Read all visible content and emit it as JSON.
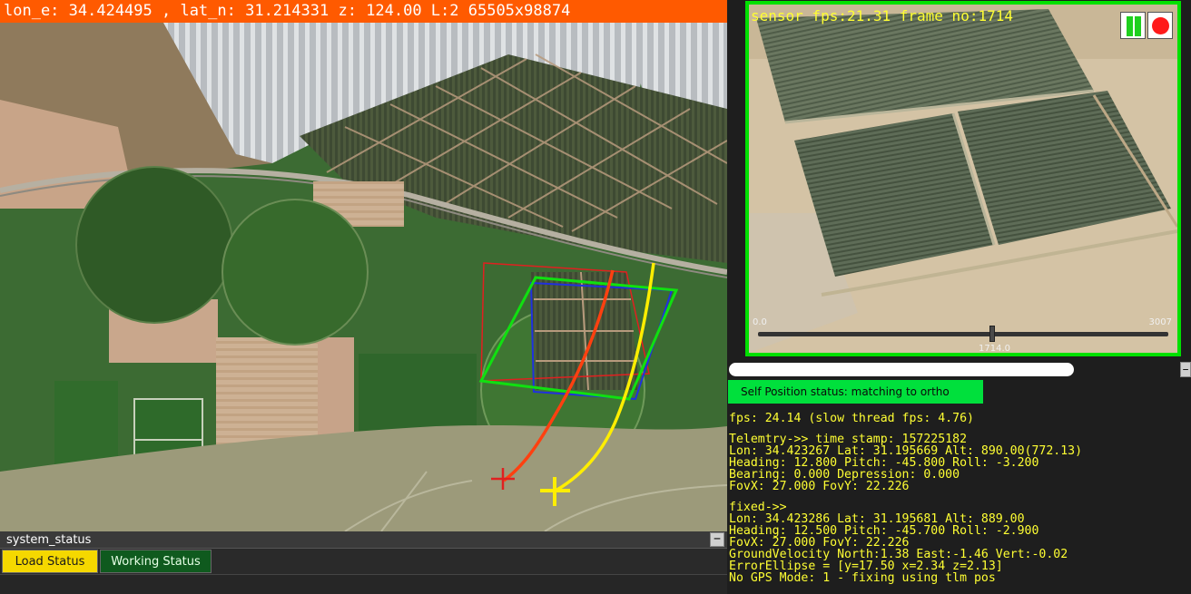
{
  "map": {
    "coord_text": "lon_e: 34.424495 , lat_n: 31.214331  z: 124.00 L:2  65505x98874"
  },
  "system_status": {
    "title": "system_status",
    "collapse_symbol": "−",
    "tabs": [
      {
        "label": "Load Status",
        "color": "#f5d800",
        "active": true
      },
      {
        "label": "Working Status",
        "color": "#0f5a1e",
        "active": false
      }
    ]
  },
  "sensor": {
    "info": "sensor fps:21.31 frame no:1714",
    "pause_icon": "pause-icon",
    "record_icon": "record-icon",
    "slider": {
      "min_label": "0.0",
      "max_label": "3007",
      "value_label": "1714.0",
      "min": 0,
      "max": 3007,
      "value": 1714
    },
    "frame_color": "#00e000"
  },
  "progress": {
    "fraction": 0.77,
    "collapse_symbol": "−"
  },
  "status": {
    "badge": "Self Position status: matching to ortho",
    "badge_color": "#00e03c",
    "text_color": "#ffff33",
    "fps_line": "fps: 24.14 (slow thread fps: 4.76)",
    "telemetry_lines": [
      "Telemtry->> time stamp: 157225182",
      "Lon: 34.423267 Lat: 31.195669 Alt: 890.00(772.13)",
      "Heading: 12.800 Pitch: -45.800 Roll: -3.200",
      "Bearing: 0.000 Depression: 0.000",
      "FovX: 27.000 FovY: 22.226"
    ],
    "fixed_lines": [
      "fixed->>",
      "Lon: 34.423286 Lat: 31.195681 Alt: 889.00",
      "Heading: 12.500 Pitch: -45.700 Roll: -2.900",
      "FovX: 27.000 FovY: 22.226",
      "GroundVelocity North:1.38 East:-1.46 Vert:-0.02",
      "ErrorEllipse = [y=17.50 x=2.34 z=2.13]",
      "No GPS Mode: 1 - fixing using tlm pos"
    ]
  }
}
